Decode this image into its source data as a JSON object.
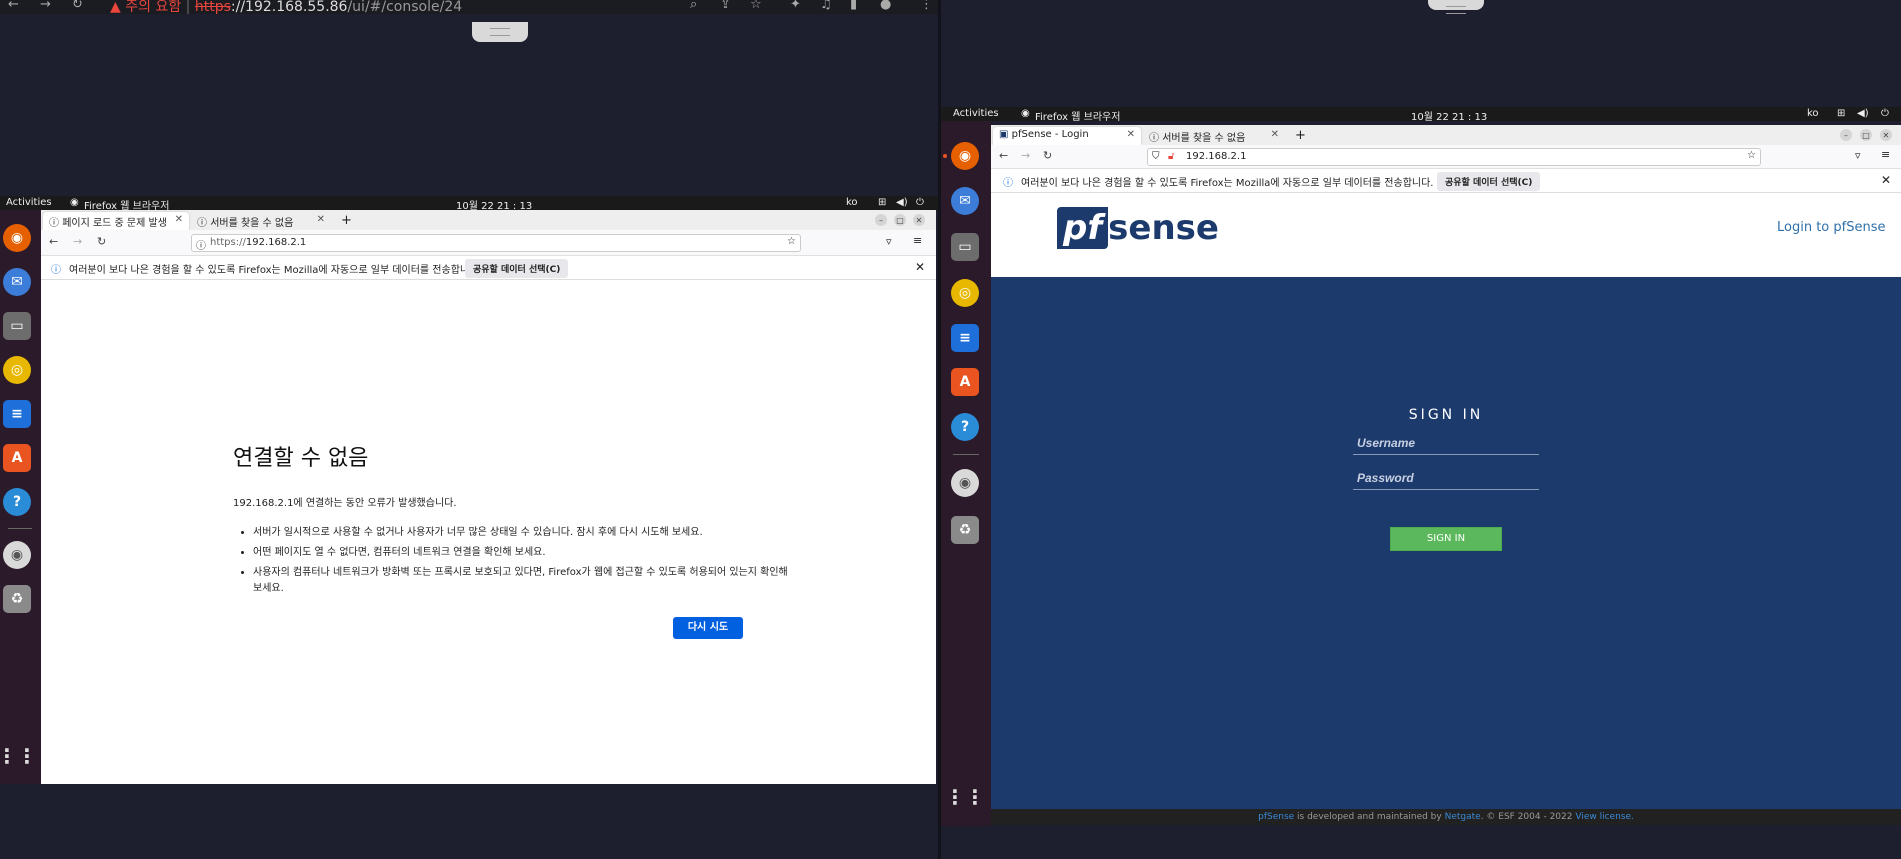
{
  "host_browser": {
    "warning_label": "주의 요함",
    "url_scheme": "https",
    "url_host": "://192.168.55.86",
    "url_path": "/ui/#/console/24"
  },
  "left_vm": {
    "topbar": {
      "activities": "Activities",
      "app": "Firefox 웹 브라우저",
      "clock": "10월 22  21 : 13",
      "lang": "ko"
    },
    "tabs": [
      {
        "label": "페이지 로드 중 문제 발생"
      },
      {
        "label": "서버를 찾을 수 없음"
      }
    ],
    "url_prefix": "https://",
    "url_host": "192.168.2.1",
    "notice_text": "여러분이 보다 나은 경험을 할 수 있도록 Firefox는 Mozilla에 자동으로 일부 데이터를 전송합니다.",
    "notice_button": "공유할 데이터 선택(C)",
    "error": {
      "title": "연결할 수 없음",
      "desc": "192.168.2.1에 연결하는 동안 오류가 발생했습니다.",
      "bullets": [
        "서버가 일시적으로 사용할 수 없거나 사용자가 너무 많은 상태일 수 있습니다. 잠시 후에 다시 시도해 보세요.",
        "어떤 페이지도 열 수 없다면, 컴퓨터의 네트워크 연결을 확인해 보세요.",
        "사용자의 컴퓨터나 네트워크가 방화벽 또는 프록시로 보호되고 있다면, Firefox가 웹에 접근할 수 있도록 허용되어 있는지 확인해 보세요."
      ],
      "retry": "다시 시도"
    }
  },
  "right_vm": {
    "topbar": {
      "activities": "Activities",
      "app": "Firefox 웹 브라우저",
      "clock": "10월 22  21 : 13",
      "lang": "ko"
    },
    "tabs": [
      {
        "label": "pfSense - Login"
      },
      {
        "label": "서버를 찾을 수 없음"
      }
    ],
    "url": "192.168.2.1",
    "notice_text": "여러분이 보다 나은 경험을 할 수 있도록 Firefox는 Mozilla에 자동으로 일부 데이터를 전송합니다.",
    "notice_button": "공유할 데이터 선택(C)",
    "pfsense": {
      "logo_pf": "pf",
      "logo_sense": "sense",
      "header_link": "Login to pfSense",
      "signin_title": "SIGN IN",
      "username_placeholder": "Username",
      "password_placeholder": "Password",
      "signin_button": "SIGN IN",
      "footer_brand": "pfSense",
      "footer_mid": " is developed and maintained by ",
      "footer_company": "Netgate",
      "footer_copy": ". © ESF 2004 - 2022 ",
      "footer_license": "View license."
    }
  },
  "colors": {
    "pf_blue": "#1d3a6c",
    "retry_blue": "#0060df",
    "signin_green": "#5cb85c"
  }
}
